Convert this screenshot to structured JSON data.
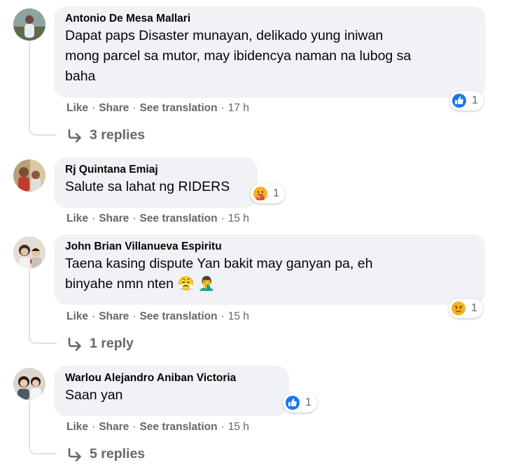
{
  "actions": {
    "like": "Like",
    "share": "Share",
    "see_translation": "See translation",
    "separator": "·"
  },
  "icons": {
    "like": "thumbs-up-icon",
    "care": "care-hug-icon",
    "sad": "sad-face-icon",
    "reply_arrow": "reply-arrow-icon"
  },
  "colors": {
    "bubble": "#f0f2f5",
    "like_blue": "#1877f2",
    "muted": "#65676b"
  },
  "comments": [
    {
      "author": "Antonio De Mesa Mallari",
      "lines": [
        "Dapat paps Disaster munayan, delikado yung iniwan",
        "mong parcel sa mutor, may ibidencya naman na lubog sa",
        "baha"
      ],
      "reaction": {
        "icon": "thumbs-up-icon",
        "count": "1"
      },
      "time": "17 h",
      "replies": "3 replies"
    },
    {
      "author": "Rj Quintana Emiaj",
      "lines": [
        "Salute sa lahat ng RIDERS"
      ],
      "reaction": {
        "icon": "care-hug-icon",
        "count": "1"
      },
      "time": "15 h",
      "replies": null
    },
    {
      "author": "John Brian Villanueva Espiritu",
      "lines": [
        "Taena kasing dispute Yan bakit may ganyan pa, eh",
        "binyahe nmn nten 😤 🤦‍♂️"
      ],
      "reaction": {
        "icon": "sad-face-icon",
        "count": "1"
      },
      "time": "15 h",
      "replies": "1 reply"
    },
    {
      "author": "Warlou Alejandro Aniban Victoria",
      "lines": [
        "Saan yan"
      ],
      "reaction": {
        "icon": "thumbs-up-icon",
        "count": "1"
      },
      "time": "15 h",
      "replies": "5 replies"
    }
  ]
}
